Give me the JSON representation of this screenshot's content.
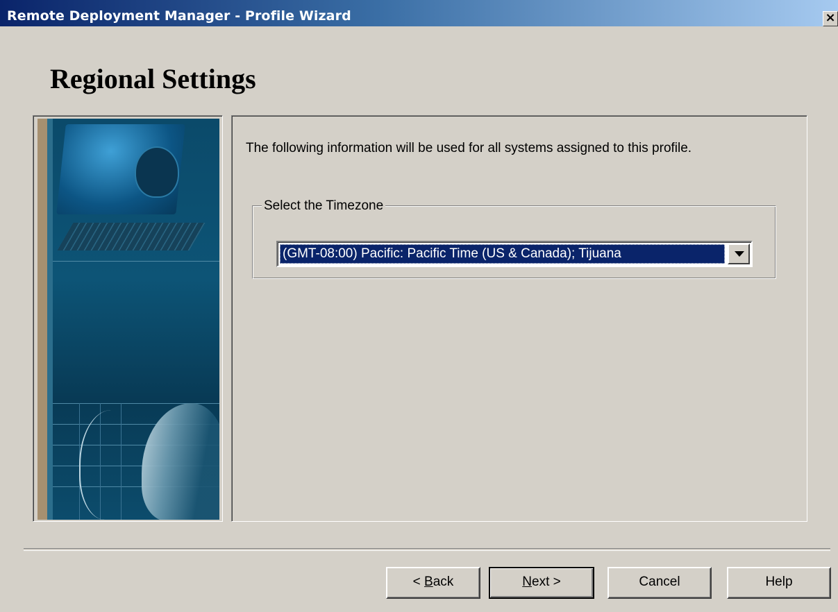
{
  "window": {
    "title": "Remote Deployment Manager - Profile Wizard",
    "close_glyph": "✕"
  },
  "page": {
    "heading": "Regional Settings",
    "intro": "The following information will be used for all systems assigned to this profile."
  },
  "timezone": {
    "group_label": "Select the Timezone",
    "selected": "(GMT-08:00) Pacific: Pacific Time (US & Canada); Tijuana"
  },
  "buttons": {
    "back_prefix": "< ",
    "back_accel": "B",
    "back_rest": "ack",
    "next_accel": "N",
    "next_rest": "ext >",
    "cancel": "Cancel",
    "help": "Help"
  },
  "icons": {
    "close": "close-icon",
    "dropdown": "chevron-down-icon"
  },
  "colors": {
    "title_bar_start": "#0a246a",
    "title_bar_end": "#a6caf0",
    "dialog_face": "#d4d0c8",
    "selection": "#0a246a"
  }
}
